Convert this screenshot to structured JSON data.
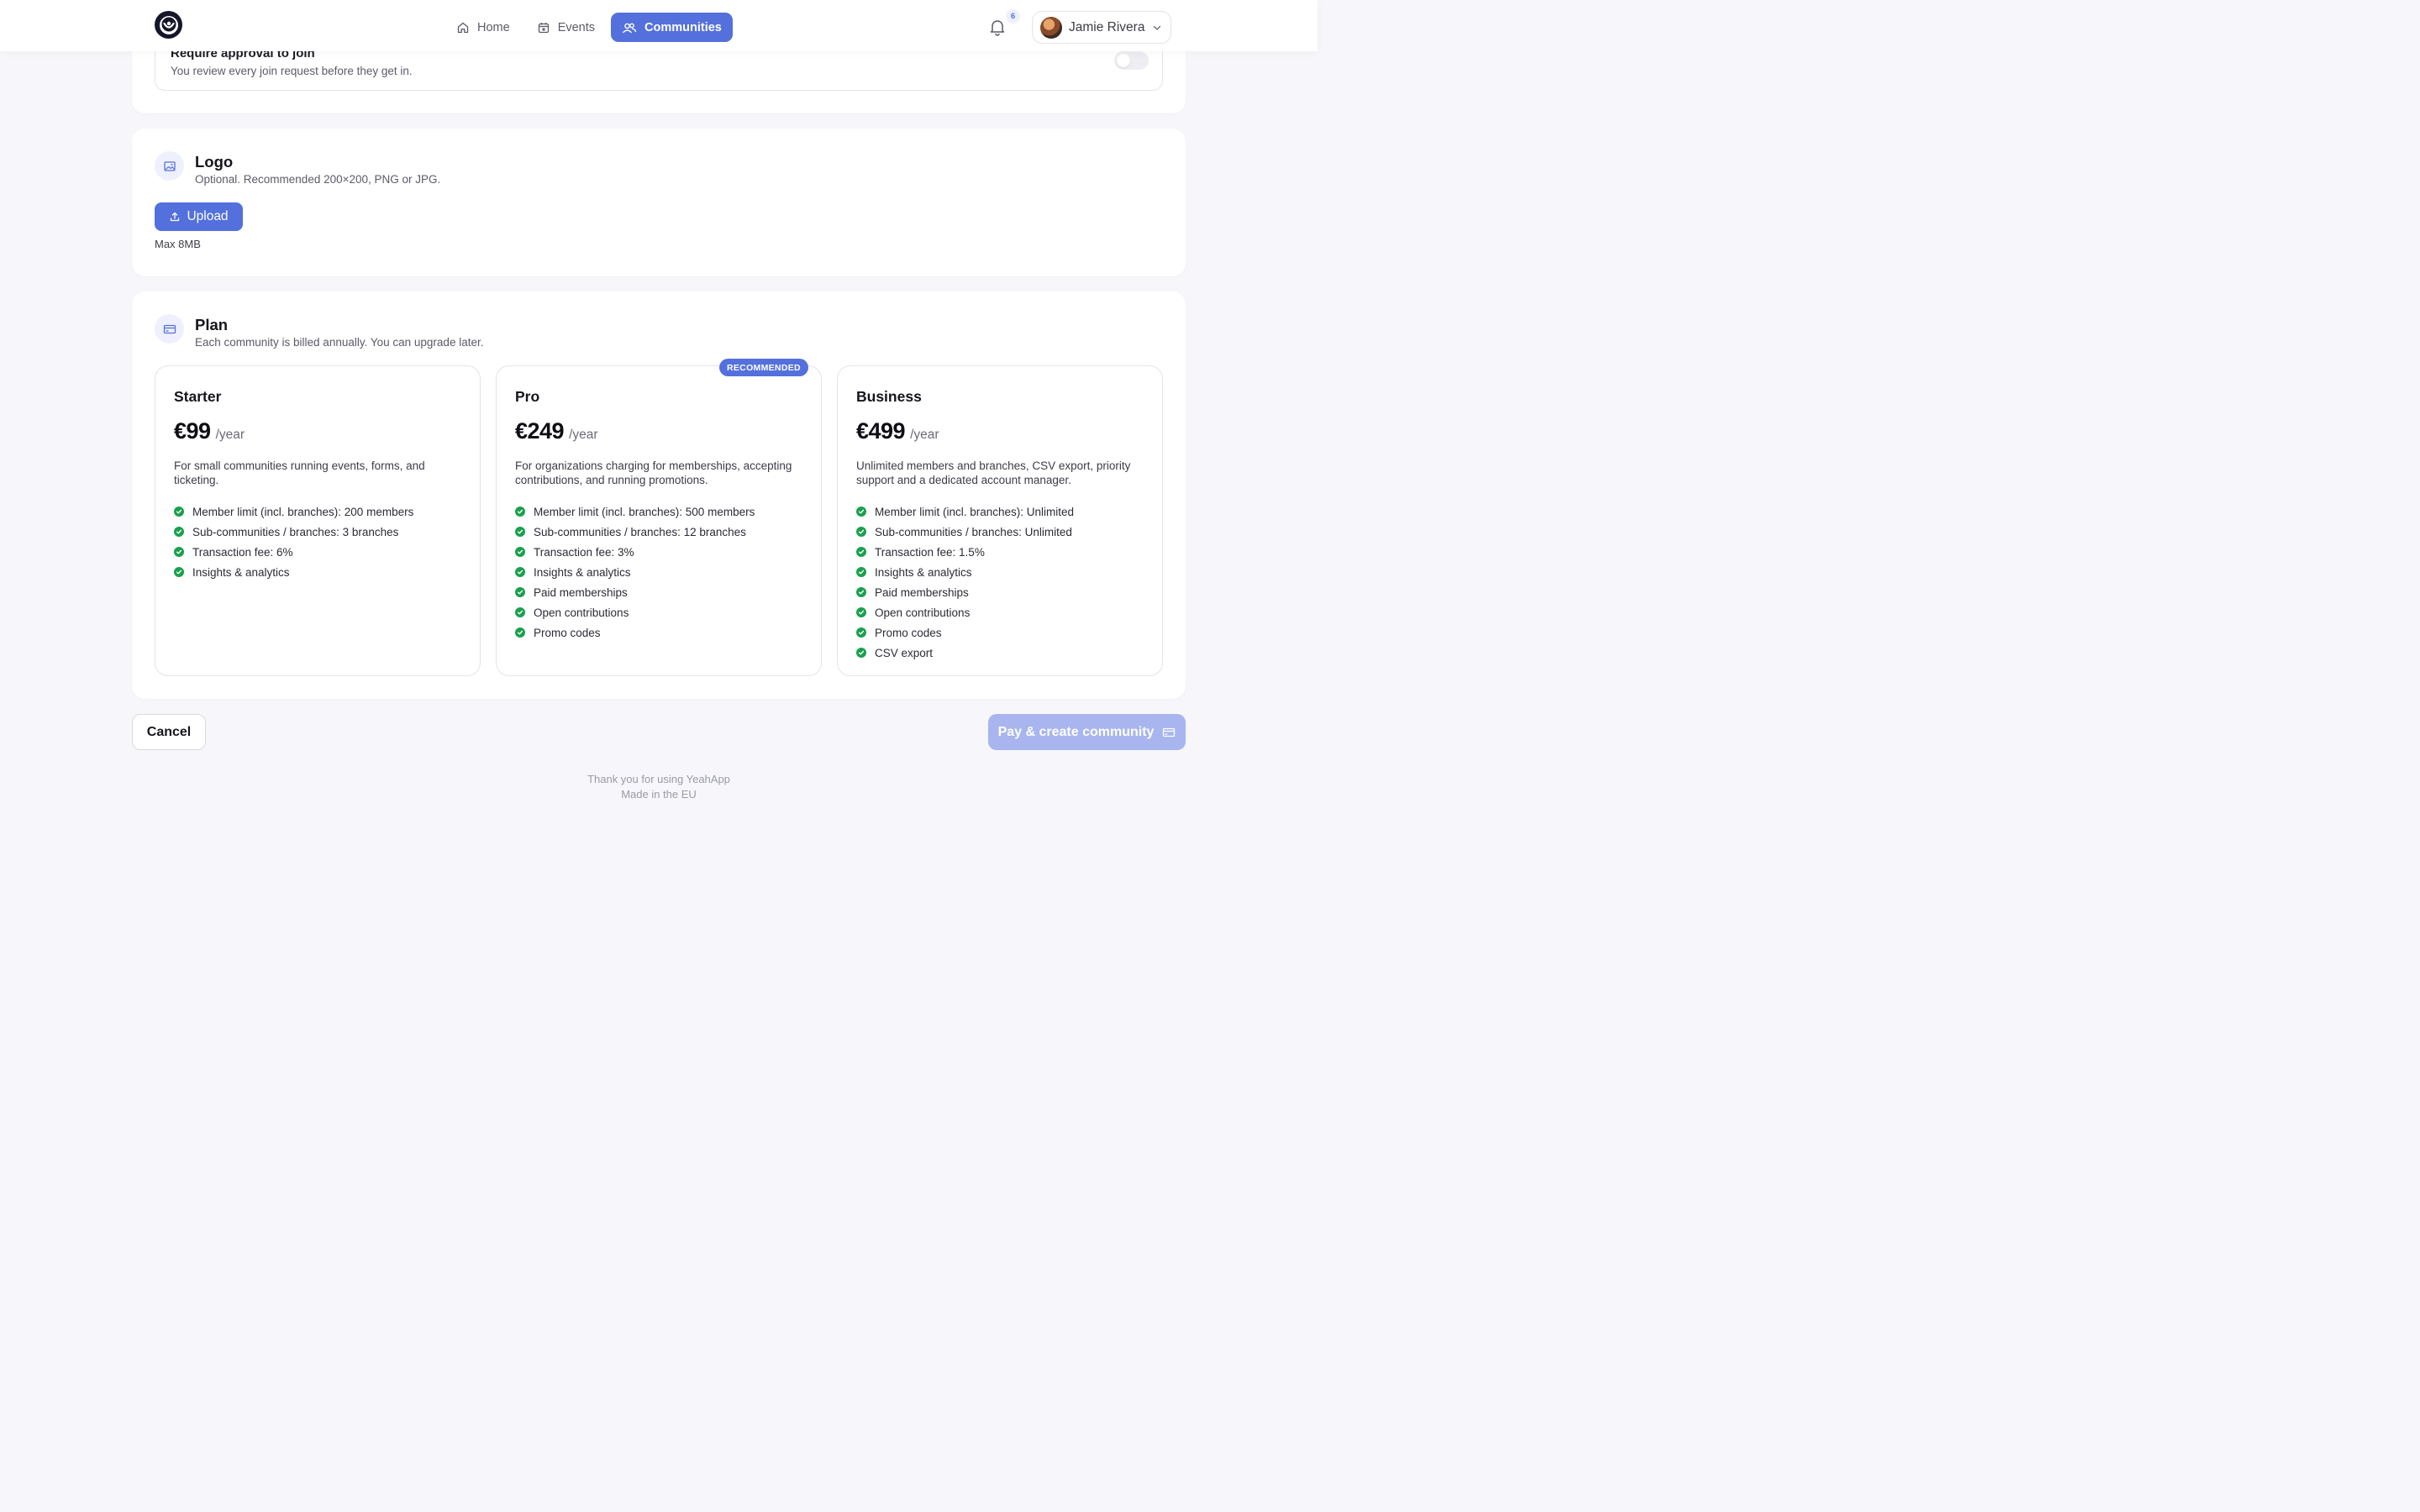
{
  "app": {
    "name": "YeahApp"
  },
  "nav": {
    "items": [
      {
        "label": "Home",
        "icon": "home-icon",
        "active": false
      },
      {
        "label": "Events",
        "icon": "calendar-icon",
        "active": false
      },
      {
        "label": "Communities",
        "icon": "users-icon",
        "active": true
      }
    ]
  },
  "header": {
    "notifications_count": "6",
    "user_name": "Jamie Rivera"
  },
  "approval": {
    "title": "Require approval to join",
    "description": "You review every join request before they get in.",
    "enabled": false
  },
  "logo_section": {
    "title": "Logo",
    "subtitle": "Optional. Recommended 200×200, PNG or JPG.",
    "upload_label": "Upload",
    "hint": "Max 8MB"
  },
  "plan_section": {
    "title": "Plan",
    "subtitle": "Each community is billed annually. You can upgrade later.",
    "plans": [
      {
        "name": "Starter",
        "price": "€99",
        "period": "/year",
        "description": "For small communities running events, forms, and ticketing.",
        "features": [
          "Member limit (incl. branches): 200 members",
          "Sub-communities / branches: 3 branches",
          "Transaction fee: 6%",
          "Insights & analytics"
        ]
      },
      {
        "name": "Pro",
        "price": "€249",
        "period": "/year",
        "badge": "RECOMMENDED",
        "description": "For organizations charging for memberships, accepting contributions, and running promotions.",
        "features": [
          "Member limit (incl. branches): 500 members",
          "Sub-communities / branches: 12 branches",
          "Transaction fee: 3%",
          "Insights & analytics",
          "Paid memberships",
          "Open contributions",
          "Promo codes"
        ]
      },
      {
        "name": "Business",
        "price": "€499",
        "period": "/year",
        "description": "Unlimited members and branches, CSV export, priority support and a dedicated account manager.",
        "features": [
          "Member limit (incl. branches): Unlimited",
          "Sub-communities / branches: Unlimited",
          "Transaction fee: 1.5%",
          "Insights & analytics",
          "Paid memberships",
          "Open contributions",
          "Promo codes",
          "CSV export"
        ]
      }
    ]
  },
  "actions": {
    "cancel_label": "Cancel",
    "pay_label": "Pay & create community"
  },
  "footer": {
    "line1": "Thank you for using YeahApp",
    "line2": "Made in the EU"
  },
  "colors": {
    "accent": "#5470dd",
    "accent_disabled": "#a8b5ee",
    "check": "#1aa04e",
    "background": "#f7f7fb"
  }
}
